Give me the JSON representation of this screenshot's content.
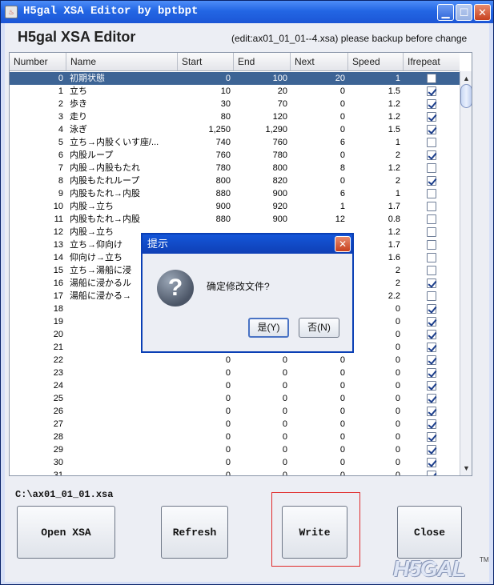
{
  "window": {
    "title": "H5gal XSA Editor by bptbpt",
    "heading": "H5gal XSA Editor",
    "backup_note": "(edit:ax01_01_01--4.xsa) please backup before change"
  },
  "table": {
    "columns": [
      "Number",
      "Name",
      "Start",
      "End",
      "Next",
      "Speed",
      "Ifrepeat"
    ],
    "rows": [
      {
        "number": "0",
        "name": "初期状態",
        "start": "0",
        "end": "100",
        "next": "20",
        "speed": "1",
        "repeat": false
      },
      {
        "number": "1",
        "name": "立ち",
        "start": "10",
        "end": "20",
        "next": "0",
        "speed": "1.5",
        "repeat": true
      },
      {
        "number": "2",
        "name": "歩き",
        "start": "30",
        "end": "70",
        "next": "0",
        "speed": "1.2",
        "repeat": true
      },
      {
        "number": "3",
        "name": "走り",
        "start": "80",
        "end": "120",
        "next": "0",
        "speed": "1.2",
        "repeat": true
      },
      {
        "number": "4",
        "name": "泳ぎ",
        "start": "1,250",
        "end": "1,290",
        "next": "0",
        "speed": "1.5",
        "repeat": true
      },
      {
        "number": "5",
        "name": "立ち→内股くいす座/...",
        "start": "740",
        "end": "760",
        "next": "6",
        "speed": "1",
        "repeat": false
      },
      {
        "number": "6",
        "name": "内股ループ",
        "start": "760",
        "end": "780",
        "next": "0",
        "speed": "2",
        "repeat": true
      },
      {
        "number": "7",
        "name": "内股→内股もたれ",
        "start": "780",
        "end": "800",
        "next": "8",
        "speed": "1.2",
        "repeat": false
      },
      {
        "number": "8",
        "name": "内股もたれループ",
        "start": "800",
        "end": "820",
        "next": "0",
        "speed": "2",
        "repeat": true
      },
      {
        "number": "9",
        "name": "内股もたれ→内股",
        "start": "880",
        "end": "900",
        "next": "6",
        "speed": "1",
        "repeat": false
      },
      {
        "number": "10",
        "name": "内股→立ち",
        "start": "900",
        "end": "920",
        "next": "1",
        "speed": "1.7",
        "repeat": false
      },
      {
        "number": "11",
        "name": "内股もたれ→内股",
        "start": "880",
        "end": "900",
        "next": "12",
        "speed": "0.8",
        "repeat": false
      },
      {
        "number": "12",
        "name": "内股→立ち",
        "start": "",
        "end": "",
        "next": "",
        "speed": "1.2",
        "repeat": false
      },
      {
        "number": "13",
        "name": "立ち→仰向け",
        "start": "",
        "end": "",
        "next": "",
        "speed": "1.7",
        "repeat": false
      },
      {
        "number": "14",
        "name": "仰向け→立ち",
        "start": "",
        "end": "",
        "next": "",
        "speed": "1.6",
        "repeat": false
      },
      {
        "number": "15",
        "name": "立ち→湯船に浸",
        "start": "",
        "end": "",
        "next": "",
        "speed": "2",
        "repeat": false
      },
      {
        "number": "16",
        "name": "湯船に浸かるル",
        "start": "",
        "end": "",
        "next": "",
        "speed": "2",
        "repeat": true
      },
      {
        "number": "17",
        "name": "湯船に浸かる→",
        "start": "",
        "end": "",
        "next": "",
        "speed": "2.2",
        "repeat": false
      },
      {
        "number": "18",
        "name": "",
        "start": "",
        "end": "",
        "next": "",
        "speed": "0",
        "repeat": true
      },
      {
        "number": "19",
        "name": "",
        "start": "",
        "end": "",
        "next": "",
        "speed": "0",
        "repeat": true
      },
      {
        "number": "20",
        "name": "",
        "start": "",
        "end": "",
        "next": "",
        "speed": "0",
        "repeat": true
      },
      {
        "number": "21",
        "name": "",
        "start": "",
        "end": "",
        "next": "",
        "speed": "0",
        "repeat": true
      },
      {
        "number": "22",
        "name": "",
        "start": "0",
        "end": "0",
        "next": "0",
        "speed": "0",
        "repeat": true
      },
      {
        "number": "23",
        "name": "",
        "start": "0",
        "end": "0",
        "next": "0",
        "speed": "0",
        "repeat": true
      },
      {
        "number": "24",
        "name": "",
        "start": "0",
        "end": "0",
        "next": "0",
        "speed": "0",
        "repeat": true
      },
      {
        "number": "25",
        "name": "",
        "start": "0",
        "end": "0",
        "next": "0",
        "speed": "0",
        "repeat": true
      },
      {
        "number": "26",
        "name": "",
        "start": "0",
        "end": "0",
        "next": "0",
        "speed": "0",
        "repeat": true
      },
      {
        "number": "27",
        "name": "",
        "start": "0",
        "end": "0",
        "next": "0",
        "speed": "0",
        "repeat": true
      },
      {
        "number": "28",
        "name": "",
        "start": "0",
        "end": "0",
        "next": "0",
        "speed": "0",
        "repeat": true
      },
      {
        "number": "29",
        "name": "",
        "start": "0",
        "end": "0",
        "next": "0",
        "speed": "0",
        "repeat": true
      },
      {
        "number": "30",
        "name": "",
        "start": "0",
        "end": "0",
        "next": "0",
        "speed": "0",
        "repeat": true
      },
      {
        "number": "31",
        "name": "",
        "start": "0",
        "end": "0",
        "next": "0",
        "speed": "0",
        "repeat": true
      }
    ],
    "selected_row": 0
  },
  "file_path": "C:\\ax01_01_01.xsa",
  "buttons": {
    "open": "Open XSA",
    "refresh": "Refresh",
    "write": "Write",
    "close": "Close"
  },
  "dialog": {
    "title": "提示",
    "message": "确定修改文件?",
    "yes": "是(Y)",
    "no": "否(N)",
    "icon": "question-icon"
  },
  "watermark": {
    "text": "H5GAL",
    "tm": "TM"
  },
  "colors": {
    "titlebar": "#2366e4",
    "selected_row": "#3d6495",
    "highlight_border": "#e02a2a"
  }
}
